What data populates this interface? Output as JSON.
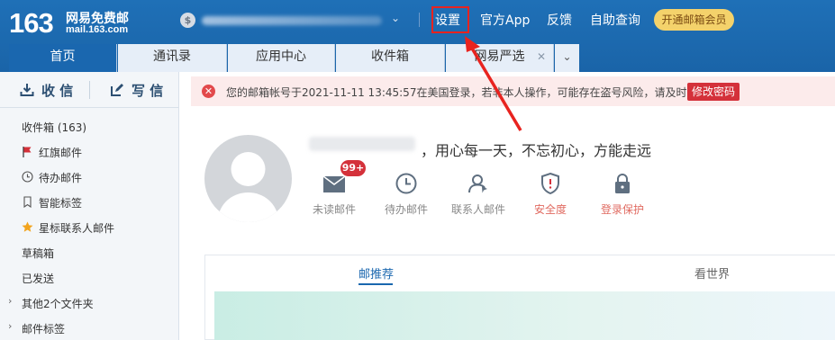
{
  "header": {
    "logo_number": "163",
    "logo_name": "网易免费邮",
    "logo_domain": "mail.163.com",
    "links": [
      "设置",
      "官方App",
      "反馈",
      "自助查询"
    ],
    "vip_button": "开通邮箱会员"
  },
  "tabs": [
    {
      "label": "首页",
      "active": true
    },
    {
      "label": "通讯录",
      "active": false
    },
    {
      "label": "应用中心",
      "active": false
    },
    {
      "label": "收件箱",
      "active": false
    },
    {
      "label": "网易严选",
      "active": false
    }
  ],
  "sidebar": {
    "receive_label": "收 信",
    "compose_label": "写 信",
    "folders": [
      {
        "label": "收件箱 (163)",
        "icon": "none"
      },
      {
        "label": "红旗邮件",
        "icon": "flag-icon"
      },
      {
        "label": "待办邮件",
        "icon": "clock-icon"
      },
      {
        "label": "智能标签",
        "icon": "bookmark-icon"
      },
      {
        "label": "星标联系人邮件",
        "icon": "star-icon"
      },
      {
        "label": "草稿箱",
        "icon": "none"
      },
      {
        "label": "已发送",
        "icon": "none"
      },
      {
        "label": "其他2个文件夹",
        "icon": "caret"
      },
      {
        "label": "邮件标签",
        "icon": "caret"
      }
    ]
  },
  "alert": {
    "text": "您的邮箱帐号于2021-11-11 13:45:57在美国登录，若非本人操作，可能存在盗号风险，请及时",
    "button": "修改密码"
  },
  "profile": {
    "motto": "，用心每一天，不忘初心，方能走远",
    "quick_actions": [
      {
        "label": "未读邮件",
        "icon": "envelope-icon"
      },
      {
        "label": "待办邮件",
        "icon": "clock-icon"
      },
      {
        "label": "联系人邮件",
        "icon": "contact-icon"
      },
      {
        "label": "安全度",
        "icon": "shield-icon"
      },
      {
        "label": "登录保护",
        "icon": "lock-icon"
      }
    ],
    "unread_badge": "99+"
  },
  "feed": {
    "tabs": [
      "邮推荐",
      "看世界"
    ]
  },
  "colors": {
    "brand_blue": "#1a67af",
    "alert_red": "#d4313a",
    "vip_gold": "#f4d26b",
    "annotation_red": "#e8231f"
  }
}
